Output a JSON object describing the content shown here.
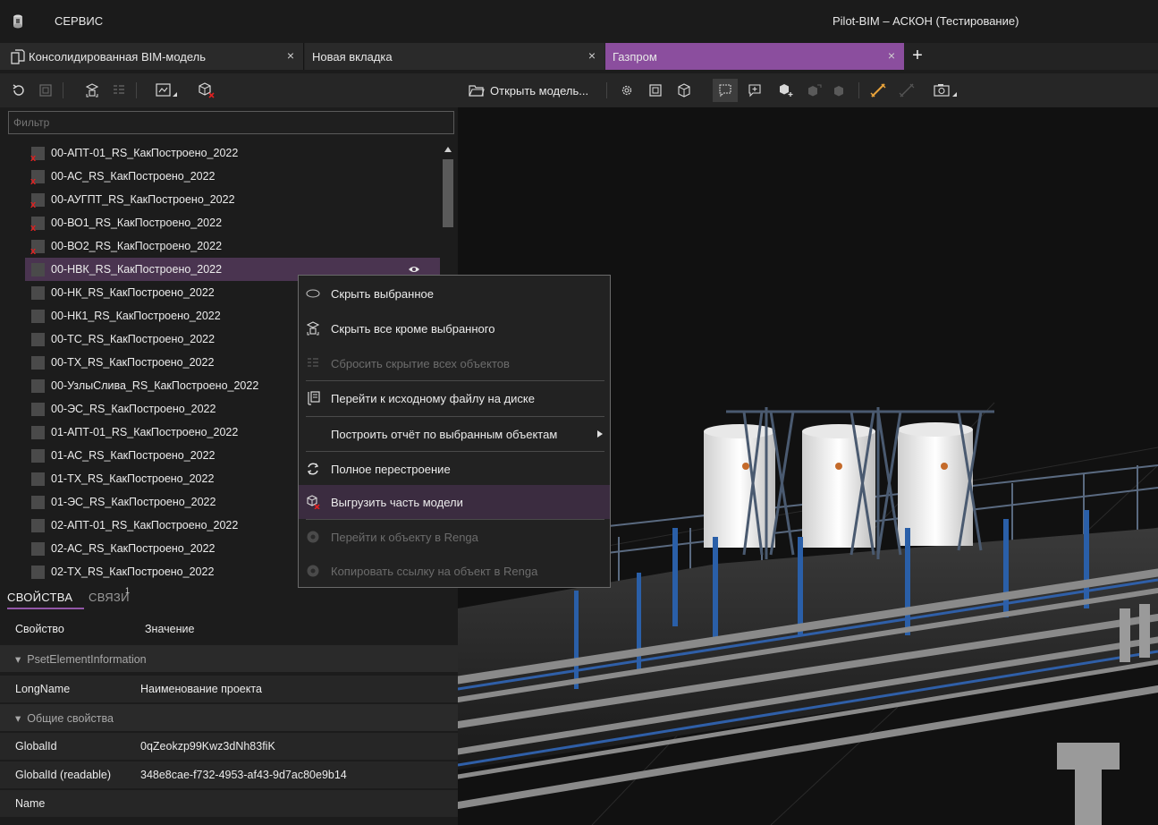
{
  "app": {
    "menu_service": "СЕРВИС",
    "window_title": "Pilot-BIM – АСКОН (Тестирование)"
  },
  "tabs": [
    {
      "label": "Консолидированная BIM-модель",
      "close": "×"
    },
    {
      "label": "Новая вкладка",
      "close": "×"
    },
    {
      "label": "Газпром",
      "close": "×"
    }
  ],
  "tab_add": "+",
  "right_toolbar": {
    "open_model_label": "Открыть модель..."
  },
  "filter": {
    "placeholder": "Фильтр"
  },
  "tree": {
    "items": [
      {
        "label": "00-АПТ-01_RS_КакПостроено_2022",
        "excluded": true
      },
      {
        "label": "00-АС_RS_КакПостроено_2022",
        "excluded": true
      },
      {
        "label": "00-АУГПТ_RS_КакПостроено_2022",
        "excluded": true
      },
      {
        "label": "00-ВО1_RS_КакПостроено_2022",
        "excluded": true
      },
      {
        "label": "00-ВО2_RS_КакПостроено_2022",
        "excluded": true
      },
      {
        "label": "00-НВК_RS_КакПостроено_2022",
        "excluded": false
      },
      {
        "label": "00-НК_RS_КакПостроено_2022",
        "excluded": false
      },
      {
        "label": "00-НК1_RS_КакПостроено_2022",
        "excluded": false
      },
      {
        "label": "00-ТС_RS_КакПостроено_2022",
        "excluded": false
      },
      {
        "label": "00-ТХ_RS_КакПостроено_2022",
        "excluded": false
      },
      {
        "label": "00-УзлыСлива_RS_КакПостроено_2022",
        "excluded": false
      },
      {
        "label": "00-ЭС_RS_КакПостроено_2022",
        "excluded": false
      },
      {
        "label": "01-АПТ-01_RS_КакПостроено_2022",
        "excluded": false
      },
      {
        "label": "01-АС_RS_КакПостроено_2022",
        "excluded": false
      },
      {
        "label": "01-ТХ_RS_КакПостроено_2022",
        "excluded": false
      },
      {
        "label": "01-ЭС_RS_КакПостроено_2022",
        "excluded": false
      },
      {
        "label": "02-АПТ-01_RS_КакПостроено_2022",
        "excluded": false
      },
      {
        "label": "02-АС_RS_КакПостроено_2022",
        "excluded": false
      },
      {
        "label": "02-ТХ_RS_КакПостроено_2022",
        "excluded": false
      }
    ],
    "excluded_mark": "x"
  },
  "properties": {
    "tab_properties": "СВОЙСТВА",
    "tab_links": "СВЯЗИ",
    "tab_links_badge": "1",
    "header_property": "Свойство",
    "header_value": "Значение",
    "group_pset": "PsetElementInformation",
    "longname_key": "LongName",
    "longname_value": "Наименование проекта",
    "group_common": "Общие свойства",
    "globalid_key": "GlobalId",
    "globalid_value": "0qZeokzp99Kwz3dNh83fiK",
    "globalid_readable_key": "GlobalId (readable)",
    "globalid_readable_value": "348e8cae-f732-4953-af43-9d7ac80e9b14",
    "name_key": "Name",
    "group_marker": "▾"
  },
  "context_menu": {
    "items": [
      {
        "label": "Скрыть выбранное"
      },
      {
        "label": "Скрыть все кроме выбранного"
      },
      {
        "label": "Сбросить скрытие всех объектов"
      },
      {
        "label": "Перейти к исходному файлу на диске"
      },
      {
        "label": "Построить отчёт по выбранным объектам"
      },
      {
        "label": "Полное перестроение"
      },
      {
        "label": "Выгрузить часть модели"
      },
      {
        "label": "Перейти к объекту в Renga"
      },
      {
        "label": "Копировать ссылку на объект в Renga"
      }
    ]
  },
  "colors": {
    "accent": "#8b4e9e",
    "selected_row": "#4a3450",
    "excluded_mark": "#e02020",
    "measure_tool": "#e8a23a"
  }
}
